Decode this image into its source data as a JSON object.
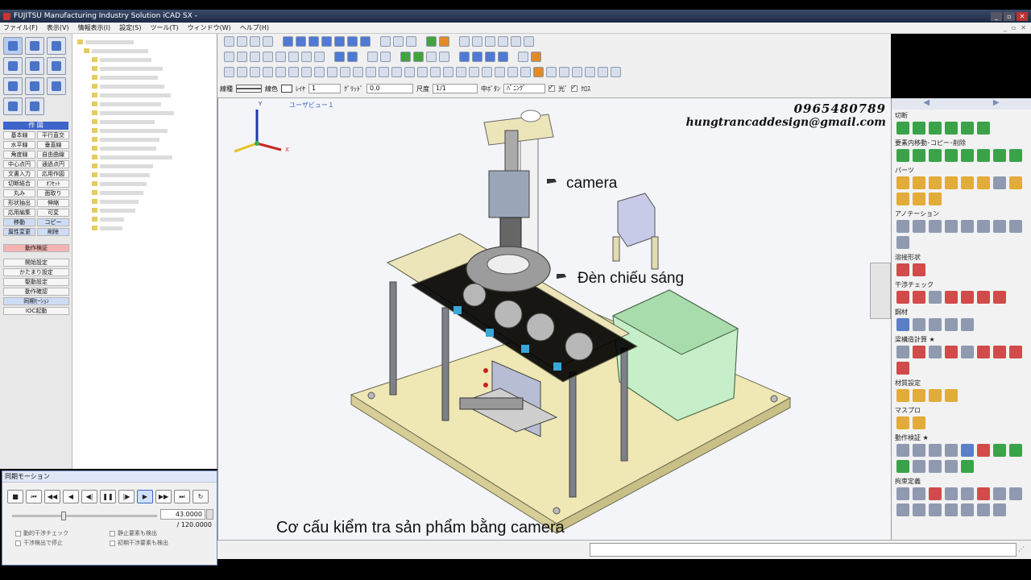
{
  "window": {
    "title": "FUJITSU Manufacturing Industry Solution iCAD SX -",
    "controls": [
      "_",
      "▫",
      "✕"
    ]
  },
  "menu": [
    "ファイル(F)",
    "表示(V)",
    "情報表示(I)",
    "設定(S)",
    "ツール(T)",
    "ウィンドウ(W)",
    "ヘルプ(H)"
  ],
  "menu_right": [
    "_",
    "▫",
    "✕"
  ],
  "left": {
    "section_draw": "作 図",
    "commands": [
      "基本線",
      "平行直交",
      "水平線",
      "垂直線",
      "角度線",
      "自由曲線",
      "中心点円",
      "通過点円",
      "文書入力",
      "応用作図",
      "切断結合",
      "ｵﾌｾｯﾄ",
      "丸み",
      "面取り",
      "形状抽出",
      "伸縮",
      "応用編集",
      "可変",
      "移動",
      "コピー",
      "属性変更",
      "削除"
    ],
    "motion_section": "動作検証",
    "motion_cmds": [
      "開始設定",
      "かたまり設定",
      "駆動設定",
      "動作確認",
      "同期ﾓｰｼｮﾝ",
      "IOC起動"
    ]
  },
  "motion_panel": {
    "title": "同期モーション",
    "buttons": [
      "■",
      "⏮",
      "◀◀",
      "◀",
      "◀|",
      "❚❚",
      "|▶",
      "▶",
      "▶▶",
      "⏭",
      "↻"
    ],
    "value": "43.0000",
    "total": "/ 120.0000",
    "progress": 0.358,
    "checks": [
      "動的干渉チェック",
      "静止要素も検出",
      "干渉検出で停止",
      "初期干渉要素も検出"
    ]
  },
  "attr": {
    "line_type_label": "線種",
    "line_color_label": "線色",
    "layer_label": "ﾚｲﾔ",
    "layer_value": "1",
    "grid_label": "ｸﾞﾘｯﾄﾞ",
    "grid_value": "0.0",
    "scale_label": "尺度",
    "scale_value": "1/1",
    "center_btn_label": "中ﾎﾞﾀﾝ",
    "center_btn_value": "ﾊﾟﾆﾝｸﾞ",
    "light_label": "光ﾞ",
    "cross_label": "ｸﾛｽ"
  },
  "viewport": {
    "view_label": "ユーザビュー１",
    "phone": "0965480789",
    "email": "hungtrancaddesign@gmail.com",
    "label_camera": "camera",
    "label_light": "Đèn chiếu sáng",
    "caption": "Cơ cấu kiểm tra sản phẩm bằng camera",
    "axes": {
      "x": "X",
      "y": "Y"
    }
  },
  "right": {
    "sections": [
      "切断",
      "要素内移動･コピー･削除",
      "パーツ",
      "アノテーション",
      "溶接形状",
      "干渉チェック",
      "鋼材",
      "梁構造計算 ★",
      "材質設定",
      "マスプロ",
      "動作検証 ★",
      "拘束定義"
    ]
  }
}
